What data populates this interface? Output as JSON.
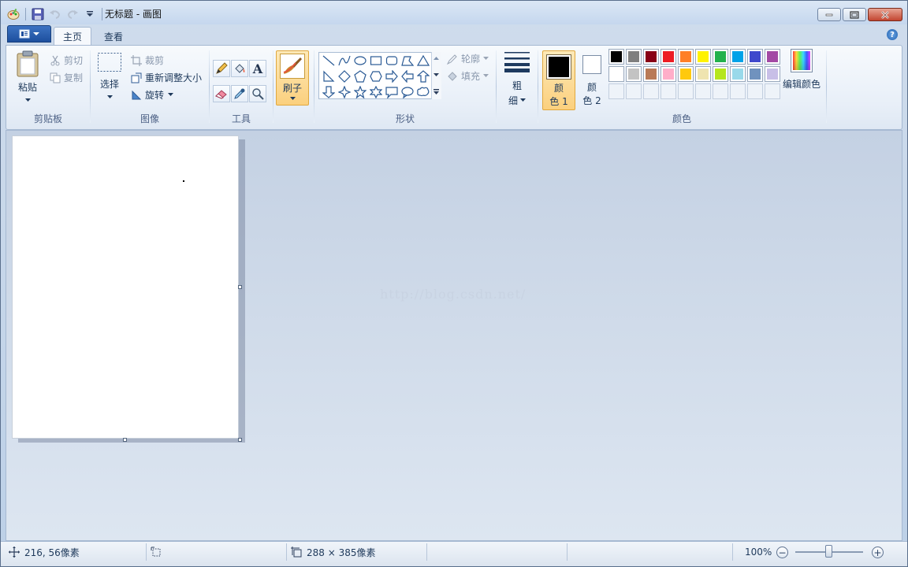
{
  "window": {
    "title": "无标题 - 画图"
  },
  "tabs": [
    {
      "label": "主页"
    },
    {
      "label": "查看"
    }
  ],
  "help_label": "?",
  "clipboard": {
    "paste": "粘贴",
    "cut": "剪切",
    "copy": "复制",
    "group": "剪贴板"
  },
  "image": {
    "select": "选择",
    "crop": "裁剪",
    "resize": "重新调整大小",
    "rotate": "旋转",
    "group": "图像"
  },
  "tools": {
    "group": "工具",
    "text_glyph": "A"
  },
  "brushes": {
    "label": "刷子"
  },
  "shapes": {
    "outline": "轮廓",
    "fill": "填充",
    "group": "形状"
  },
  "size": {
    "label_line1": "粗",
    "label_line2": "细"
  },
  "colors": {
    "color1_line1": "颜",
    "color1_line2": "色 1",
    "color2_line1": "颜",
    "color2_line2": "色 2",
    "edit": "编辑颜色",
    "group": "颜色",
    "color1": "#000000",
    "color2": "#ffffff",
    "palette_row1": [
      "#000000",
      "#7f7f7f",
      "#880015",
      "#ed1c24",
      "#ff7f27",
      "#fff200",
      "#22b14c",
      "#00a2e8",
      "#3f48cc",
      "#a349a4"
    ],
    "palette_row2": [
      "#ffffff",
      "#c3c3c3",
      "#b97a57",
      "#ffaec9",
      "#ffc90e",
      "#efe4b0",
      "#b5e61d",
      "#99d9ea",
      "#7092be",
      "#c8bfe7"
    ]
  },
  "canvas": {
    "watermark": "http://blog.csdn.net/"
  },
  "status": {
    "position": "216, 56像素",
    "size": "288 × 385像素",
    "zoom": "100%",
    "zoom_out": "−",
    "zoom_in": "+"
  }
}
